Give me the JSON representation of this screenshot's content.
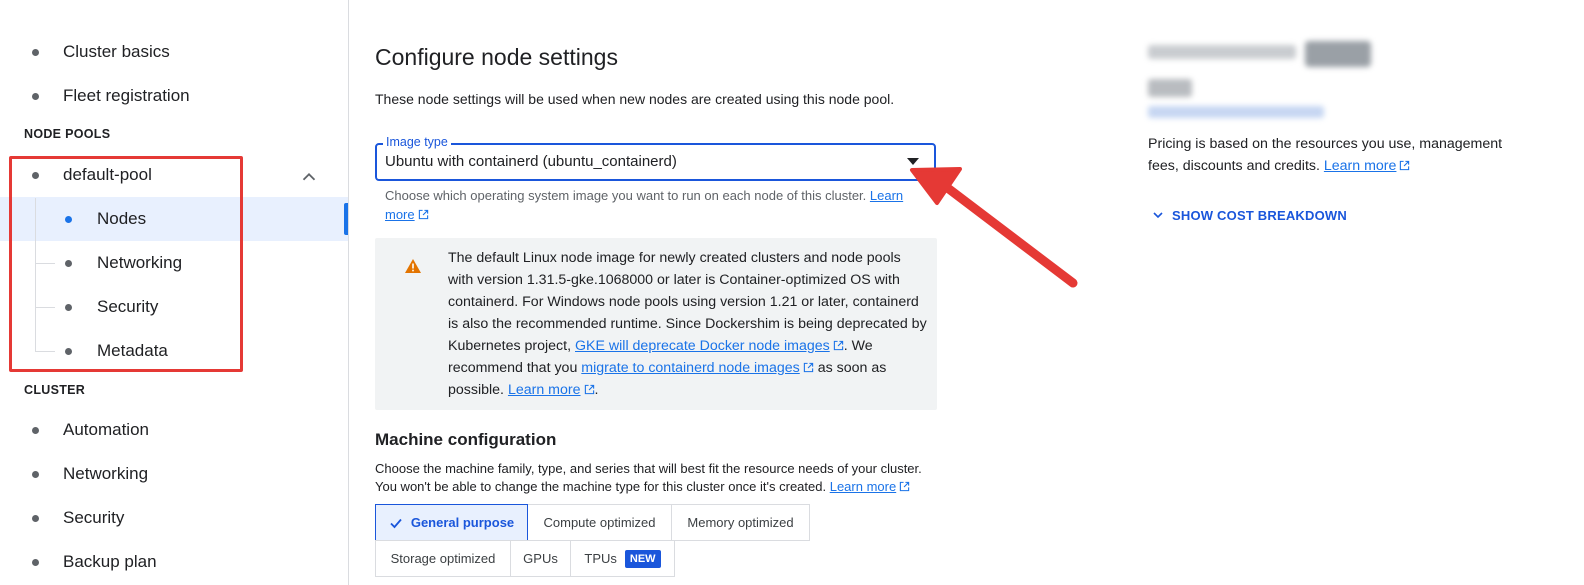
{
  "sidebar": {
    "items_top": [
      {
        "label": "Cluster basics"
      },
      {
        "label": "Fleet registration"
      }
    ],
    "node_pools_label": "NODE POOLS",
    "pool": {
      "label": "default-pool",
      "children": [
        {
          "label": "Nodes",
          "active": true
        },
        {
          "label": "Networking"
        },
        {
          "label": "Security"
        },
        {
          "label": "Metadata"
        }
      ]
    },
    "cluster_label": "CLUSTER",
    "cluster_items": [
      {
        "label": "Automation"
      },
      {
        "label": "Networking"
      },
      {
        "label": "Security"
      },
      {
        "label": "Backup plan"
      }
    ]
  },
  "main": {
    "title": "Configure node settings",
    "description": "These node settings will be used when new nodes are created using this node pool.",
    "image_type": {
      "legend": "Image type",
      "value": "Ubuntu with containerd (ubuntu_containerd)",
      "helper": "Choose which operating system image you want to run on each node of this cluster.",
      "helper_link": "Learn more"
    },
    "warning": {
      "text_1": "The default Linux node image for newly created clusters and node pools with version 1.31.5-gke.1068000 or later is Container-optimized OS with containerd. For Windows node pools using version 1.21 or later, containerd is also the recommended runtime. Since Dockershim is being deprecated by Kubernetes project,",
      "link_1": "GKE will deprecate Docker node images",
      "text_2": ". We recommend that you",
      "link_2": "migrate to containerd node images",
      "text_3": "as soon as possible.",
      "link_3": "Learn more",
      "text_4": "."
    },
    "machine": {
      "title": "Machine configuration",
      "description": "Choose the machine family, type, and series that will best fit the resource needs of your cluster. You won't be able to change the machine type for this cluster once it's created.",
      "description_link": "Learn more",
      "tabs_row1": [
        "General purpose",
        "Compute optimized",
        "Memory optimized"
      ],
      "tabs_row2": [
        "Storage optimized",
        "GPUs",
        "TPUs"
      ],
      "selected": "General purpose",
      "new_badge": "NEW"
    }
  },
  "right_panel": {
    "pricing_text": "Pricing is based on the resources you use, management fees, discounts and credits.",
    "pricing_link": "Learn more",
    "cost_breakdown": "SHOW COST BREAKDOWN"
  },
  "colors": {
    "accent": "#1a56db",
    "annotation_red": "#e53935",
    "warning": "#e37400"
  }
}
